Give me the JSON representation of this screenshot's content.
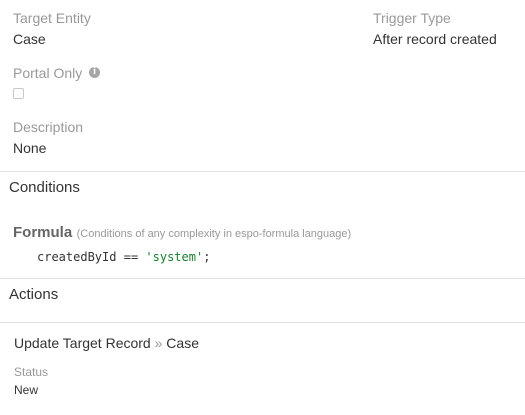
{
  "fields": {
    "target_entity": {
      "label": "Target Entity",
      "value": "Case"
    },
    "trigger_type": {
      "label": "Trigger Type",
      "value": "After record created"
    },
    "portal_only": {
      "label": "Portal Only",
      "info_icon": "info-circle-icon",
      "checked": false
    },
    "description": {
      "label": "Description",
      "value": "None"
    }
  },
  "conditions": {
    "title": "Conditions",
    "formula_label": "Formula",
    "formula_note": "(Conditions of any complexity in espo-formula language)",
    "code": {
      "identifier": "createdById",
      "operator": "==",
      "string": "'system'",
      "terminator": ";"
    }
  },
  "actions": {
    "title": "Actions",
    "action_title": "Update Target Record",
    "separator": "»",
    "action_entity": "Case",
    "field_label": "Status",
    "field_value": "New"
  },
  "colors": {
    "string_literal": "#1a7f2f",
    "muted": "#999999",
    "divider": "#e2e2e2"
  }
}
